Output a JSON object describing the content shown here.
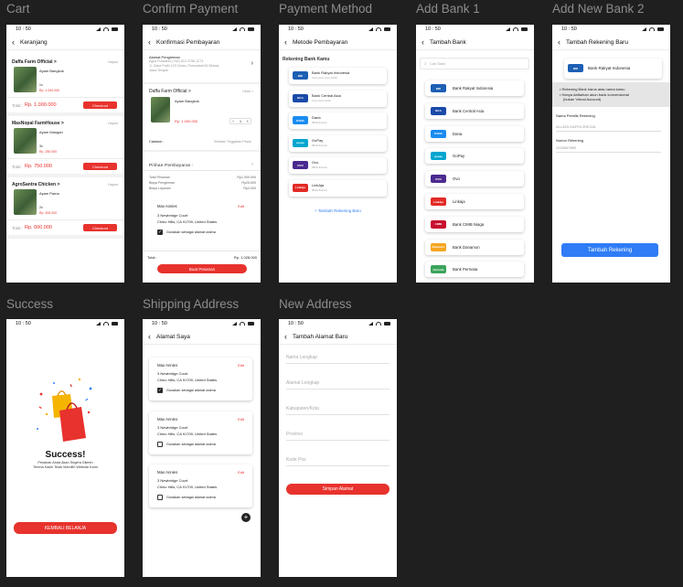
{
  "labels": {
    "cart": "Cart",
    "confirm": "Confirm Payment",
    "method": "Payment Method",
    "add1": "Add Bank 1",
    "add2": "Add New Bank 2",
    "success": "Success",
    "shipping": "Shipping Address",
    "newaddr": "New Address"
  },
  "status_time": "10 : 50",
  "cart": {
    "title": "Keranjang",
    "hapus": "Hapus",
    "checkout": "Checkout",
    "total_label": "Total :",
    "stores": [
      {
        "name": "Daffa Farm Official >",
        "product": "Ayam Bangkok",
        "qty": "1x",
        "price": "Rp. 1.000.000",
        "total": "Rp. 1.000.000"
      },
      {
        "name": "MasNopal FarmHouse >",
        "product": "Ayam Mangan",
        "qty": "3x",
        "price": "Rp. 250.000",
        "total": "Rp. 750.000"
      },
      {
        "name": "AgroSantra Chicken >",
        "product": "Ayam Pama",
        "qty": "2x",
        "price": "Rp. 300.000",
        "total": "Rp. 600.000"
      }
    ]
  },
  "confirm": {
    "title": "Konfirmasi Pembayaran",
    "addr_label": "Alamat Pengiriman",
    "addr_line1": "Agus Purwanto (+62) 812-3756-1273",
    "addr_line2": "Jl. Gatot Patih 123 Ciriwu, Purwodadi 62 Bekasi,",
    "addr_line3": "Jawa Tengah",
    "store": "Daffa Farm Official >",
    "ubah": "Ubah >",
    "product": "Ayam Bangkok",
    "price": "Rp. 1.000.000",
    "qty": "1",
    "catatan": "Catatan :",
    "catatan_ph": "Silahkan Tinggalkan Pesan",
    "pilihan": "Pilihan Pembayaran :",
    "rows": [
      {
        "k": "Total Pesanan",
        "v": "Rp1.000.000"
      },
      {
        "k": "Biaya Pengiriman",
        "v": "Rp25.000"
      },
      {
        "k": "Biaya Layanan",
        "v": "Rp3.000"
      }
    ],
    "name": "Max Annies",
    "edit": "Edit",
    "street": "3 Newbridge Court",
    "city": "Chino Hills, CA 91709, United States",
    "use_main": "Gunakan sebagai alamat utama",
    "total": "Total :",
    "total_val": "Rp. 1.028.000",
    "button": "Buat Pesanan"
  },
  "method": {
    "title": "Metode Pembayaran",
    "section": "Rekening Bank Kamu",
    "add": "+ Tambah Rekening Baru",
    "banks": [
      {
        "name": "Bank Rakyat Indonesia",
        "num": "xxxx-xxxx-xxxx-1234",
        "logo": "BRI",
        "color": "#1d5fb4"
      },
      {
        "name": "Bank Central Asia",
        "num": "xxxx-xxxx-1234",
        "logo": "BCA",
        "color": "#1a4aa8"
      },
      {
        "name": "Dana",
        "num": "0812-3xxxxx",
        "logo": "DANA",
        "color": "#1a8cf0"
      },
      {
        "name": "GoPay",
        "num": "0812-3xxxxx",
        "logo": "gopay",
        "color": "#00a5cf"
      },
      {
        "name": "Ovo",
        "num": "0812-3xxxxx",
        "logo": "OVO",
        "color": "#4b2a8f"
      },
      {
        "name": "LinkAja",
        "num": "0812-3xxxxx",
        "logo": "LinkAja",
        "color": "#e22a26"
      }
    ]
  },
  "add1": {
    "title": "Tambah Bank",
    "search": "Cari Bank",
    "banks": [
      {
        "name": "Bank Rakyat Indonesia",
        "logo": "BRI",
        "color": "#1d5fb4"
      },
      {
        "name": "Bank Central Asia",
        "logo": "BCA",
        "color": "#1a4aa8"
      },
      {
        "name": "Dana",
        "logo": "DANA",
        "color": "#1a8cf0"
      },
      {
        "name": "GoPay",
        "logo": "gopay",
        "color": "#00a5cf"
      },
      {
        "name": "Ovo",
        "logo": "OVO",
        "color": "#4b2a8f"
      },
      {
        "name": "Linkaja",
        "logo": "LinkAja",
        "color": "#e22a26"
      },
      {
        "name": "Bank CIMB Niaga",
        "logo": "CIMB",
        "color": "#c8102e"
      },
      {
        "name": "Bank Danamon",
        "logo": "Danamon",
        "color": "#f5a623"
      },
      {
        "name": "Bank Permata",
        "logo": "Permata",
        "color": "#3aa35b"
      }
    ]
  },
  "add2": {
    "title": "Tambah Rekening Baru",
    "bank": "Bank Rakyat Indonesia",
    "logo": "BRI",
    "info1": "• Rekening Bank harus atas nama kamu",
    "info2": "• Hanya daftarkan akun bank konvensional",
    "info3": "(bukan Virtual Account)",
    "owner_label": "Nama Pemilik Rekening",
    "owner_value": "ALLATA DAFFA ZHEZAL",
    "num_label": "Nomor Rekening",
    "num_value": "1234567890",
    "button": "Tambah Rekening"
  },
  "success": {
    "title": "Success!",
    "line1": "Pesanan Anda Akan Segera Dikirim",
    "line2": "Terima Kasih Telah Memilih Website Kami",
    "button": "KEMBALI BELANJA"
  },
  "shipping": {
    "title": "Alamat Saya",
    "edit": "Edit",
    "use": "Gunakan sebagai alamat utama",
    "addresses": [
      {
        "name": "Max Annies",
        "street": "3 Newbridge Court",
        "city": "Chino Hills, CA 91709, United States",
        "checked": true
      },
      {
        "name": "Max Annies",
        "street": "3 Newbridge Court",
        "city": "Chino Hills, CA 91709, United States",
        "checked": false
      },
      {
        "name": "Max Annies",
        "street": "3 Newbridge Court",
        "city": "Chino Hills, CA 91709, United States",
        "checked": false
      }
    ]
  },
  "newaddr": {
    "title": "Tambah Alamat Baru",
    "fields": [
      "Nama Lengkap",
      "Alamat Lengkap",
      "Kabupaten/Kota",
      "Provinsi",
      "Kode Pos"
    ],
    "button": "Simpan Alamat"
  },
  "colors": {
    "red": "#e8322d",
    "blue": "#2f7cf6",
    "bg": "#1f1f1f"
  }
}
